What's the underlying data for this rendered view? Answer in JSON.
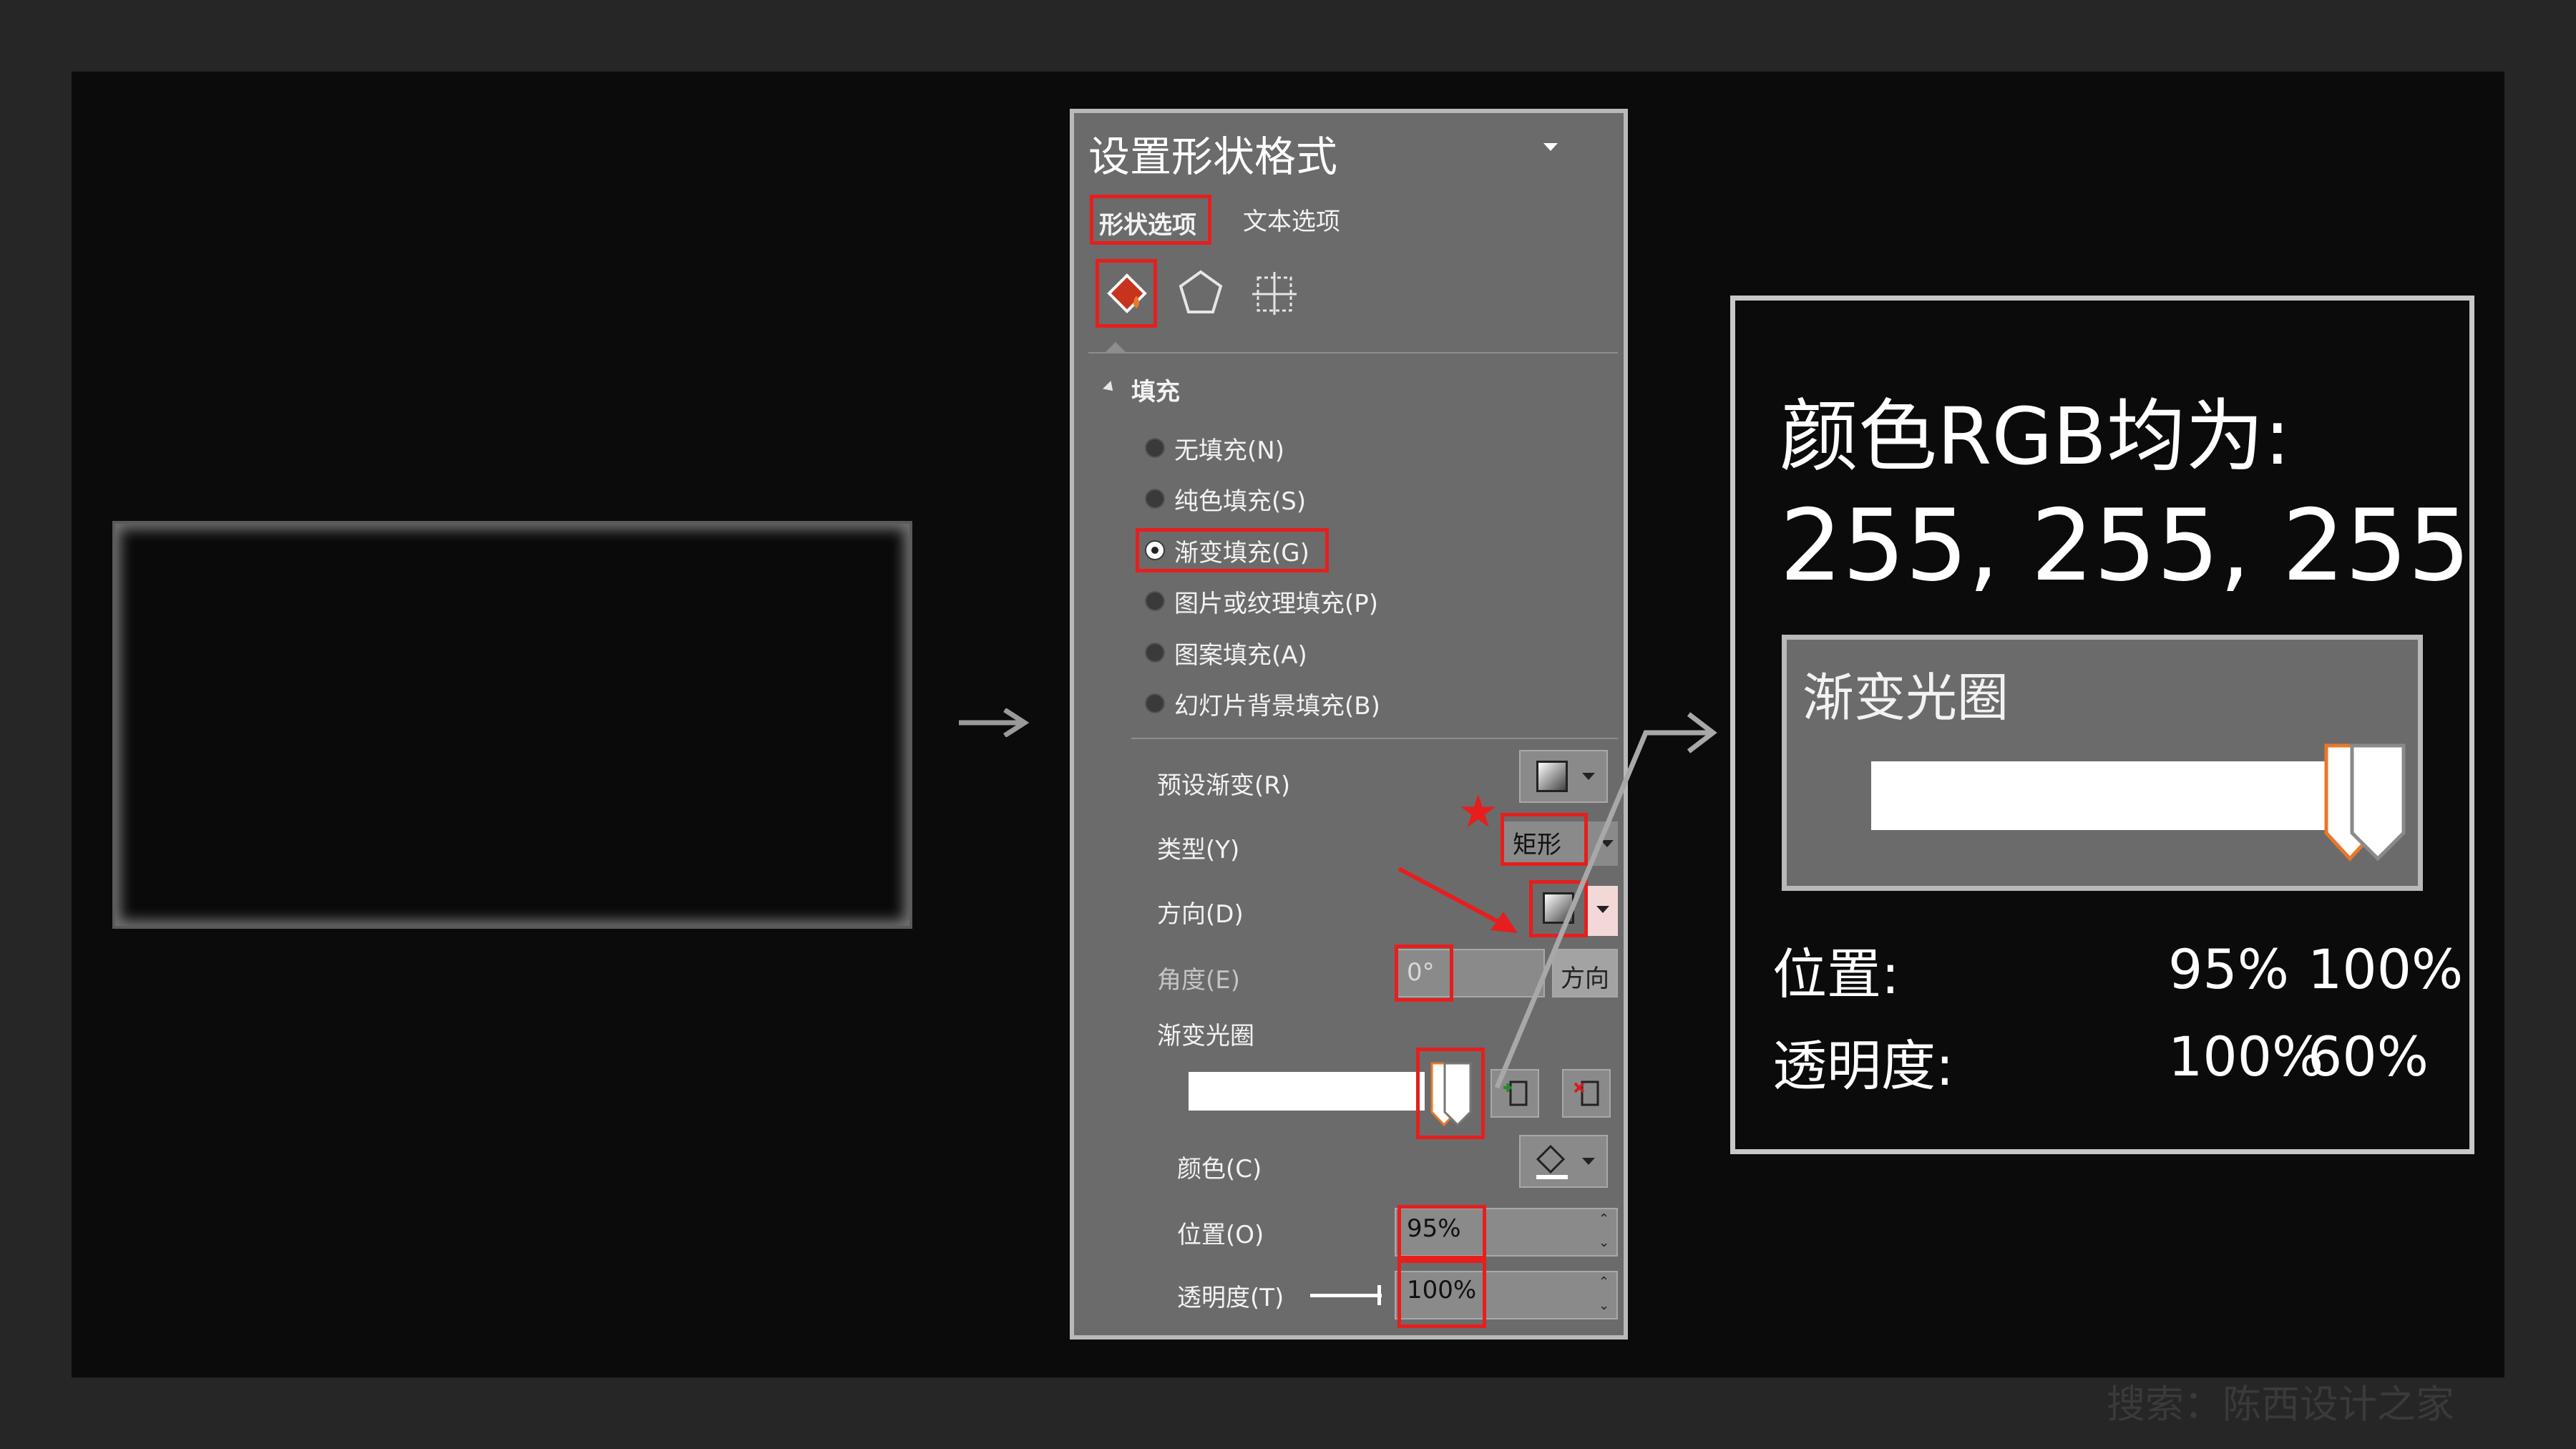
{
  "pane": {
    "title": "设置形状格式",
    "tabs": [
      "形状选项",
      "文本选项"
    ],
    "section_fill": "填充",
    "fill_options": [
      "无填充(N)",
      "纯色填充(S)",
      "渐变填充(G)",
      "图片或纹理填充(P)",
      "图案填充(A)",
      "幻灯片背景填充(B)"
    ],
    "selected_fill": "渐变填充(G)",
    "preset_label": "预设渐变(R)",
    "type_label": "类型(Y)",
    "type_value": "矩形",
    "direction_label": "方向(D)",
    "angle_label": "角度(E)",
    "angle_value": "0°",
    "angle_button": "方向",
    "stops_label": "渐变光圈",
    "color_label": "颜色(C)",
    "position_label": "位置(O)",
    "position_value": "95%",
    "transparency_label": "透明度(T)",
    "transparency_value": "100%"
  },
  "info": {
    "heading": "颜色RGB均为:",
    "rgb": "255, 255, 255",
    "gradient_label": "渐变光圈",
    "position_label": "位置:",
    "position_values": [
      "95%",
      "100%"
    ],
    "transparency_label": "透明度:",
    "transparency_values": [
      "100%",
      "60%"
    ]
  },
  "annotation": {
    "star": "★"
  },
  "watermark": "搜索：陈西设计之家",
  "colors": {
    "highlight": "#e61e1e",
    "stop_orange": "#e8782a"
  },
  "icons": [
    "fill-bucket-icon",
    "pentagon-icon",
    "size-layout-icon",
    "add-stop-icon",
    "remove-stop-icon",
    "paint-bucket-icon",
    "dropdown-caret-icon",
    "right-arrow-icon"
  ]
}
